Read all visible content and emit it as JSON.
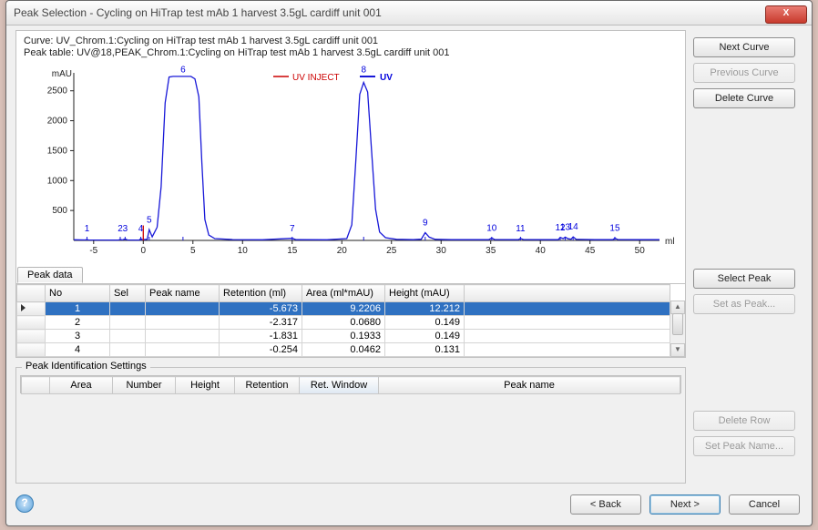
{
  "window": {
    "title": "Peak Selection - Cycling on HiTrap test mAb 1 harvest 3.5gL cardiff unit  001",
    "close": "X"
  },
  "meta": {
    "curve_line": "Curve: UV_Chrom.1:Cycling on HiTrap test mAb 1 harvest 3.5gL cardiff unit  001",
    "table_line": "Peak table: UV@18,PEAK_Chrom.1:Cycling on HiTrap test mAb 1 harvest 3.5gL cardiff unit  001"
  },
  "buttons": {
    "next_curve": "Next Curve",
    "prev_curve": "Previous Curve",
    "delete_curve": "Delete Curve",
    "select_peak": "Select Peak",
    "set_as_peak": "Set as Peak...",
    "delete_row": "Delete Row",
    "set_peak_name": "Set Peak Name...",
    "back": "< Back",
    "next": "Next >",
    "cancel": "Cancel"
  },
  "tabs": {
    "peak_data": "Peak data"
  },
  "legend": {
    "inject": "UV INJECT",
    "uv": "UV"
  },
  "chart_data": {
    "type": "line",
    "xlabel": "ml",
    "ylabel": "mAU",
    "xlim": [
      -7,
      52
    ],
    "ylim": [
      0,
      2800
    ],
    "xticks": [
      -5,
      0,
      5,
      10,
      15,
      20,
      25,
      30,
      35,
      40,
      45,
      50
    ],
    "yticks": [
      500,
      1000,
      1500,
      2000,
      2500
    ],
    "peaks_annot": [
      {
        "x": -5.67,
        "label": "1"
      },
      {
        "x": -2.32,
        "label": "2"
      },
      {
        "x": -1.83,
        "label": "3"
      },
      {
        "x": -0.25,
        "label": "4"
      },
      {
        "x": 0.6,
        "label": "5"
      },
      {
        "x": 4.0,
        "label": "6"
      },
      {
        "x": 15.0,
        "label": "7"
      },
      {
        "x": 22.2,
        "label": "8"
      },
      {
        "x": 28.4,
        "label": "9"
      },
      {
        "x": 35.1,
        "label": "10"
      },
      {
        "x": 38.0,
        "label": "11"
      },
      {
        "x": 42.0,
        "label": "12"
      },
      {
        "x": 42.5,
        "label": "13"
      },
      {
        "x": 43.3,
        "label": "14"
      },
      {
        "x": 47.5,
        "label": "15"
      }
    ],
    "inject_marker_x": 0.0,
    "series": [
      {
        "name": "UV",
        "interp": "linear",
        "points": [
          [
            -7,
            10
          ],
          [
            -5.9,
            8
          ],
          [
            -5.67,
            12
          ],
          [
            -5.5,
            8
          ],
          [
            -2.5,
            6
          ],
          [
            -2.32,
            15
          ],
          [
            -2.1,
            8
          ],
          [
            -1.83,
            25
          ],
          [
            -1.6,
            8
          ],
          [
            -0.4,
            6
          ],
          [
            -0.25,
            30
          ],
          [
            -0.1,
            10
          ],
          [
            0.4,
            18
          ],
          [
            0.6,
            180
          ],
          [
            0.9,
            60
          ],
          [
            1.4,
            220
          ],
          [
            1.8,
            900
          ],
          [
            2.2,
            2300
          ],
          [
            2.6,
            2730
          ],
          [
            3.0,
            2740
          ],
          [
            3.6,
            2740
          ],
          [
            4.2,
            2740
          ],
          [
            4.8,
            2740
          ],
          [
            5.2,
            2700
          ],
          [
            5.6,
            2400
          ],
          [
            5.9,
            1300
          ],
          [
            6.2,
            350
          ],
          [
            6.6,
            90
          ],
          [
            7.2,
            30
          ],
          [
            9.0,
            14
          ],
          [
            12,
            10
          ],
          [
            15.0,
            35
          ],
          [
            15.4,
            12
          ],
          [
            18.5,
            10
          ],
          [
            20.5,
            30
          ],
          [
            21.0,
            260
          ],
          [
            21.4,
            1300
          ],
          [
            21.8,
            2440
          ],
          [
            22.2,
            2640
          ],
          [
            22.6,
            2480
          ],
          [
            23.0,
            1500
          ],
          [
            23.4,
            520
          ],
          [
            23.8,
            140
          ],
          [
            24.4,
            45
          ],
          [
            25.5,
            18
          ],
          [
            27.2,
            12
          ],
          [
            28.0,
            20
          ],
          [
            28.4,
            130
          ],
          [
            28.8,
            55
          ],
          [
            29.4,
            18
          ],
          [
            31,
            12
          ],
          [
            34.8,
            12
          ],
          [
            35.1,
            40
          ],
          [
            35.4,
            14
          ],
          [
            37.8,
            12
          ],
          [
            38.0,
            34
          ],
          [
            38.3,
            14
          ],
          [
            41.8,
            12
          ],
          [
            42.0,
            48
          ],
          [
            42.3,
            30
          ],
          [
            42.5,
            55
          ],
          [
            42.8,
            28
          ],
          [
            43.1,
            20
          ],
          [
            43.3,
            60
          ],
          [
            43.6,
            18
          ],
          [
            45.5,
            12
          ],
          [
            47.3,
            12
          ],
          [
            47.5,
            38
          ],
          [
            47.8,
            14
          ],
          [
            50,
            12
          ],
          [
            52,
            12
          ]
        ]
      }
    ]
  },
  "table": {
    "headers": {
      "no": "No",
      "sel": "Sel",
      "name": "Peak name",
      "ret": "Retention (ml)",
      "area": "Area (ml*mAU)",
      "height": "Height (mAU)"
    },
    "rows": [
      {
        "no": "1",
        "sel": "",
        "name": "",
        "ret": "-5.673",
        "area": "9.2206",
        "height": "12.212",
        "selected": true
      },
      {
        "no": "2",
        "sel": "",
        "name": "",
        "ret": "-2.317",
        "area": "0.0680",
        "height": "0.149"
      },
      {
        "no": "3",
        "sel": "",
        "name": "",
        "ret": "-1.831",
        "area": "0.1933",
        "height": "0.149"
      },
      {
        "no": "4",
        "sel": "",
        "name": "",
        "ret": "-0.254",
        "area": "0.0462",
        "height": "0.131"
      }
    ]
  },
  "ident": {
    "legend": "Peak Identification Settings",
    "headers": {
      "area": "Area",
      "number": "Number",
      "height": "Height",
      "retention": "Retention",
      "ret_window": "Ret. Window",
      "peak_name": "Peak name"
    }
  }
}
